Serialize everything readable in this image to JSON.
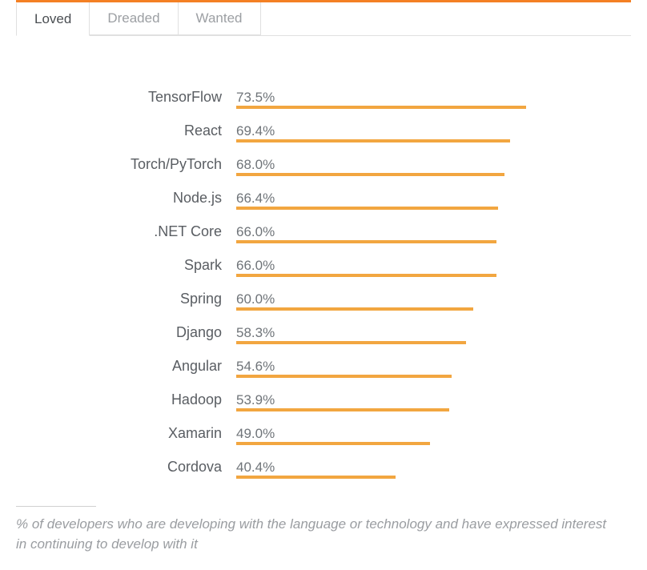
{
  "tabs": [
    {
      "label": "Loved",
      "active": true
    },
    {
      "label": "Dreaded",
      "active": false
    },
    {
      "label": "Wanted",
      "active": false
    }
  ],
  "footnote": "% of developers who are developing with the language or technology and have expressed interest in continuing to develop with it",
  "colors": {
    "accent": "#f48024",
    "bar": "#f2a640"
  },
  "chart_data": {
    "type": "bar",
    "orientation": "horizontal",
    "title": "",
    "xlabel": "",
    "ylabel": "",
    "xlim": [
      0,
      100
    ],
    "categories": [
      "TensorFlow",
      "React",
      "Torch/PyTorch",
      "Node.js",
      ".NET Core",
      "Spark",
      "Spring",
      "Django",
      "Angular",
      "Hadoop",
      "Xamarin",
      "Cordova"
    ],
    "values": [
      73.5,
      69.4,
      68.0,
      66.4,
      66.0,
      66.0,
      60.0,
      58.3,
      54.6,
      53.9,
      49.0,
      40.4
    ],
    "value_suffix": "%"
  }
}
